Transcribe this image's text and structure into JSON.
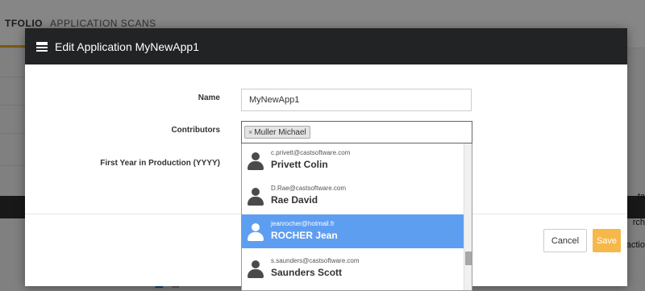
{
  "background": {
    "tabs": [
      "TFOLIO",
      "APPLICATION SCANS"
    ],
    "right_fragments": [
      "ta",
      "rch",
      "actio"
    ],
    "row_actions": [
      "✎",
      "✕",
      "+",
      "👤",
      "▦"
    ]
  },
  "modal": {
    "title": "Edit Application MyNewApp1",
    "fields": {
      "name_label": "Name",
      "name_value": "MyNewApp1",
      "contributors_label": "Contributors",
      "contributor_tag": "Muller Michael",
      "tag_remove": "×",
      "year_label": "First Year in Production (YYYY)"
    },
    "buttons": {
      "cancel": "Cancel",
      "save": "Save"
    }
  },
  "dropdown": {
    "items": [
      {
        "email": "c.privett@castsoftware.com",
        "name": "Privett Colin"
      },
      {
        "email": "D.Rae@castsoftware.com",
        "name": "Rae David"
      },
      {
        "email": "jeanrocher@hotmail.fr",
        "name": "ROCHER Jean"
      },
      {
        "email": "s.saunders@castsoftware.com",
        "name": "Saunders Scott"
      }
    ],
    "selected_index": 2
  },
  "colors": {
    "header_bg": "#222325",
    "accent_save": "#f6b84a",
    "highlight": "#5e9ef1",
    "tab_underline": "#e3a221"
  }
}
